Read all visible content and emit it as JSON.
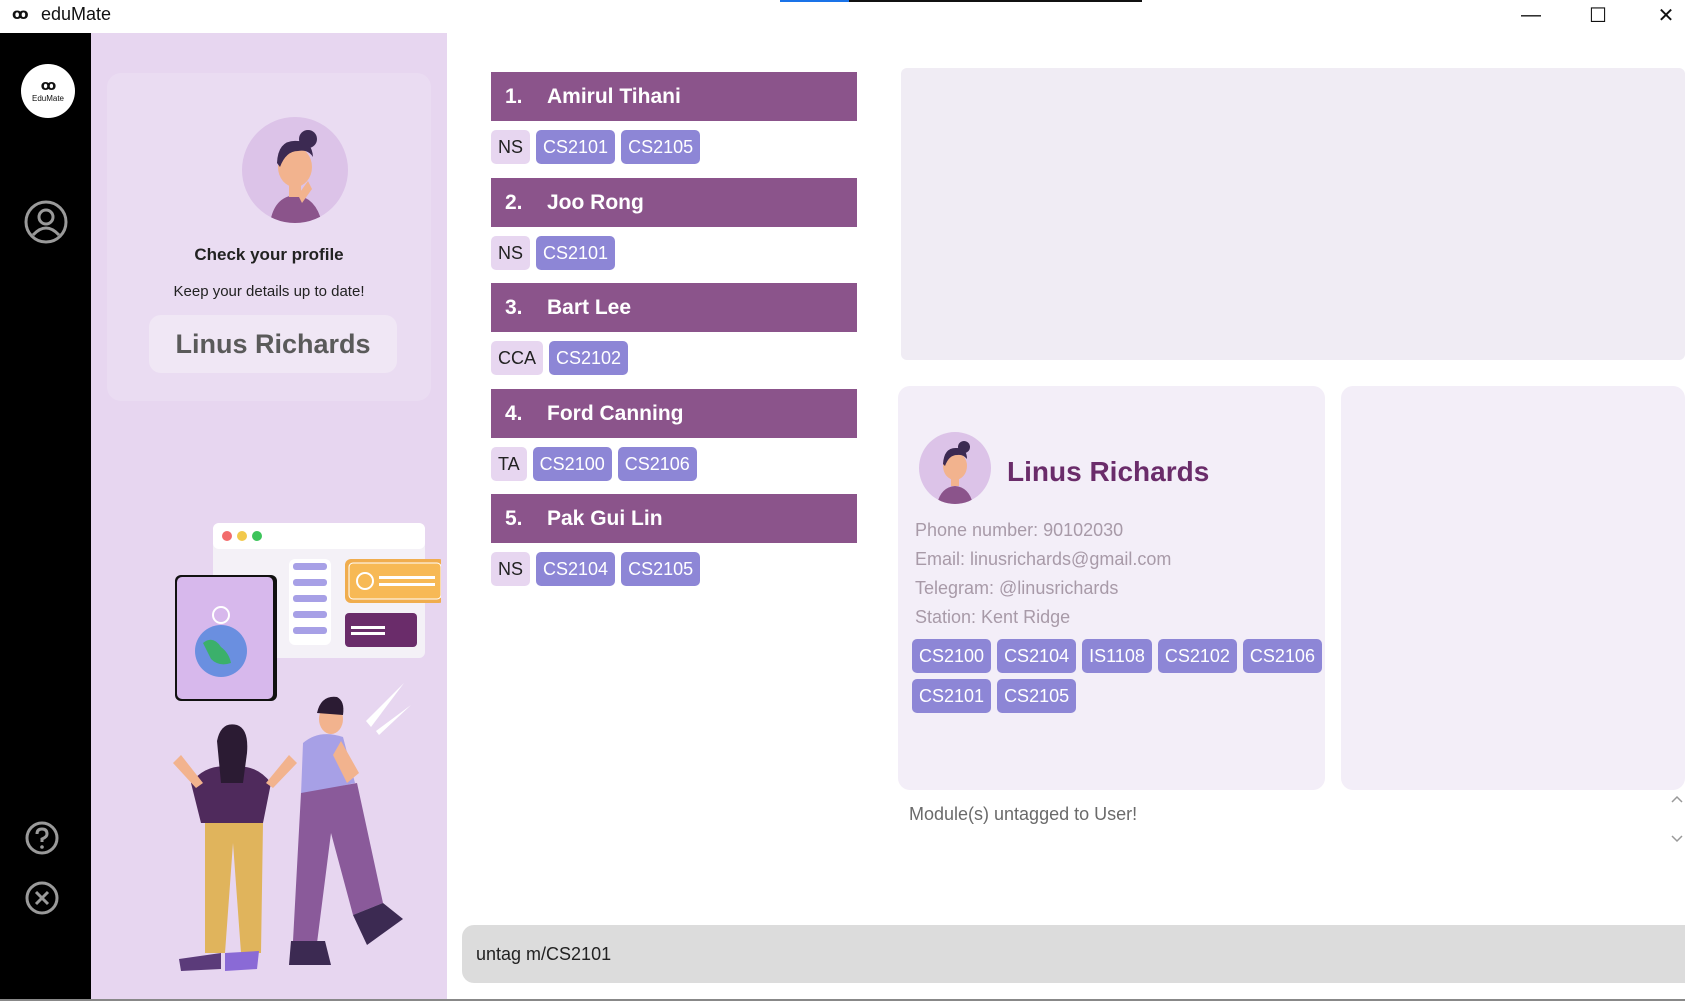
{
  "window": {
    "logo_glyph": "ꝏ",
    "title": "eduMate",
    "progress_fraction": 0.19,
    "minimize_glyph": "—",
    "maximize_glyph": "☐",
    "close_glyph": "✕"
  },
  "nav": {
    "logo_glyph": "ꝏ",
    "logo_text": "EduMate",
    "icons": [
      "profile-icon",
      "help-icon",
      "exit-icon"
    ]
  },
  "profile": {
    "title": "Check your profile",
    "subtitle": "Keep your details up to date!",
    "name": "Linus Richards"
  },
  "contacts": [
    {
      "index": "1.",
      "name": "Amirul Tihani",
      "tags": [
        {
          "text": "NS",
          "kind": "group"
        },
        {
          "text": "CS2101",
          "kind": "mod"
        },
        {
          "text": "CS2105",
          "kind": "mod"
        }
      ]
    },
    {
      "index": "2.",
      "name": "Joo Rong",
      "tags": [
        {
          "text": "NS",
          "kind": "group"
        },
        {
          "text": "CS2101",
          "kind": "mod"
        }
      ]
    },
    {
      "index": "3.",
      "name": "Bart Lee",
      "tags": [
        {
          "text": "CCA",
          "kind": "group"
        },
        {
          "text": "CS2102",
          "kind": "mod"
        }
      ]
    },
    {
      "index": "4.",
      "name": "Ford Canning",
      "tags": [
        {
          "text": "TA",
          "kind": "group"
        },
        {
          "text": "CS2100",
          "kind": "mod"
        },
        {
          "text": "CS2106",
          "kind": "mod"
        }
      ]
    },
    {
      "index": "5.",
      "name": "Pak Gui Lin",
      "tags": [
        {
          "text": "NS",
          "kind": "group"
        },
        {
          "text": "CS2104",
          "kind": "mod"
        },
        {
          "text": "CS2105",
          "kind": "mod"
        }
      ]
    }
  ],
  "detail": {
    "name": "Linus Richards",
    "phone": "Phone number: 90102030",
    "email": "Email: linusrichards@gmail.com",
    "telegram": "Telegram: @linusrichards",
    "station": "Station: Kent Ridge",
    "modules": [
      "CS2100",
      "CS2104",
      "IS1108",
      "CS2102",
      "CS2106",
      "CS2101",
      "CS2105"
    ]
  },
  "result": {
    "message": "Module(s) untagged to User!"
  },
  "command": {
    "value": "untag m/CS2101"
  },
  "colors": {
    "accent": "#8b548b",
    "module_tag": "#8d86d6",
    "group_tag": "#e7d6f0",
    "panel_bg": "#e7d6f0",
    "name_color": "#6a2c6a"
  }
}
